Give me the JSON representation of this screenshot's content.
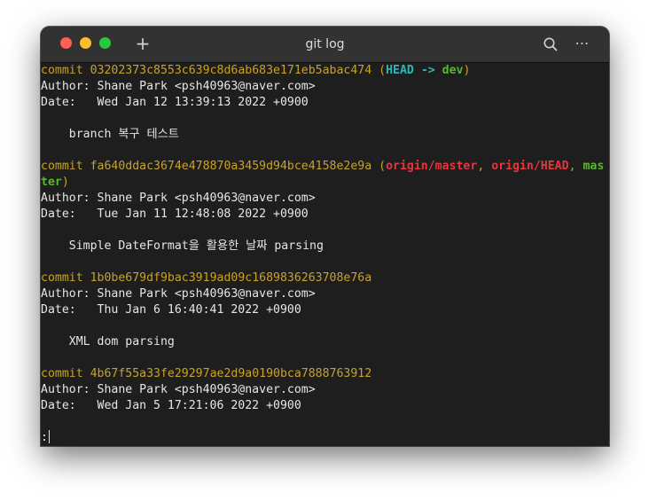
{
  "window": {
    "title": "git log",
    "new_tab_label": "+",
    "more_label": "⋯"
  },
  "commits": [
    {
      "commit_label": "commit",
      "hash": "03202373c8553c639c8d6ab683e171eb5abac474",
      "refs_open": "(",
      "head": "HEAD",
      "arrow": "->",
      "branch": "dev",
      "refs_close": ")",
      "author": "Author: Shane Park <psh40963@naver.com>",
      "date": "Date:   Wed Jan 12 13:39:13 2022 +0900",
      "message": "    branch 복구 테스트"
    },
    {
      "commit_label": "commit",
      "hash": "fa640ddac3674e478870a3459d94bce4158e2e9a",
      "refs_open": "(",
      "remote1": "origin/master",
      "sep1": ",",
      "remote2": "origin/HEAD",
      "sep2": ",",
      "local_part1": "mas",
      "local_part2": "ter",
      "refs_close": ")",
      "author": "Author: Shane Park <psh40963@naver.com>",
      "date": "Date:   Tue Jan 11 12:48:08 2022 +0900",
      "message": "    Simple DateFormat을 활용한 날짜 parsing"
    },
    {
      "commit_label": "commit",
      "hash": "1b0be679df9bac3919ad09c1689836263708e76a",
      "author": "Author: Shane Park <psh40963@naver.com>",
      "date": "Date:   Thu Jan 6 16:40:41 2022 +0900",
      "message": "    XML dom parsing"
    },
    {
      "commit_label": "commit",
      "hash": "4b67f55a33fe29297ae2d9a0190bca7888763912",
      "author": "Author: Shane Park <psh40963@naver.com>",
      "date": "Date:   Wed Jan 5 17:21:06 2022 +0900"
    }
  ],
  "prompt": ":",
  "colors": {
    "hash": "#c9a227",
    "head": "#2cb7b7",
    "branch": "#58b82d",
    "remote": "#e5363c",
    "text": "#e6e6e6",
    "background": "#1e1e1e"
  }
}
